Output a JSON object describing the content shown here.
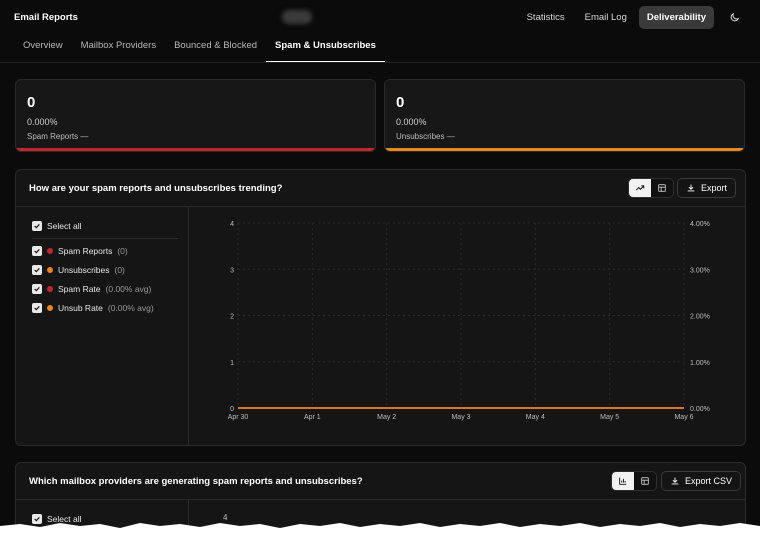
{
  "app": {
    "title": "Email Reports"
  },
  "topnav": {
    "items": [
      {
        "label": "Statistics",
        "active": false
      },
      {
        "label": "Email Log",
        "active": false
      },
      {
        "label": "Deliverability",
        "active": true
      }
    ],
    "theme_icon": "moon-icon"
  },
  "tabs": [
    {
      "label": "Overview",
      "active": false
    },
    {
      "label": "Mailbox Providers",
      "active": false
    },
    {
      "label": "Bounced & Blocked",
      "active": false
    },
    {
      "label": "Spam & Unsubscribes",
      "active": true
    }
  ],
  "stats": [
    {
      "value": "0",
      "percent": "0.000%",
      "label": "Spam Reports —",
      "color": "#c0272d"
    },
    {
      "value": "0",
      "percent": "0.000%",
      "label": "Unsubscribes —",
      "color": "#e8881d"
    }
  ],
  "trend_panel": {
    "title": "How are your spam reports and unsubscribes trending?",
    "export_label": "Export",
    "select_all": "Select all",
    "series": [
      {
        "label": "Spam Reports",
        "meta": "(0)",
        "color": "#c0272d"
      },
      {
        "label": "Unsubscribes",
        "meta": "(0)",
        "color": "#e8881d"
      },
      {
        "label": "Spam Rate",
        "meta": "(0.00% avg)",
        "color": "#c0272d"
      },
      {
        "label": "Unsub Rate",
        "meta": "(0.00% avg)",
        "color": "#e8881d"
      }
    ]
  },
  "providers_panel": {
    "title": "Which mailbox providers are generating spam reports and unsubscribes?",
    "export_label": "Export CSV",
    "select_all": "Select all",
    "first_tick": "4"
  },
  "chart_data": {
    "type": "line",
    "x": [
      "Apr 30",
      "Apr 1",
      "May 2",
      "May 3",
      "May 4",
      "May 5",
      "May 6"
    ],
    "ylim": [
      0,
      4
    ],
    "y_ticks": [
      "4",
      "3",
      "2",
      "1",
      "0"
    ],
    "y2lim": [
      0,
      4
    ],
    "y2_ticks": [
      "4.00%",
      "3.00%",
      "2.00%",
      "1.00%",
      "0.00%"
    ],
    "grid": true,
    "series": [
      {
        "name": "Spam Reports",
        "values": [
          0,
          0,
          0,
          0,
          0,
          0,
          0
        ],
        "color": "#c0272d"
      },
      {
        "name": "Unsubscribes",
        "values": [
          0,
          0,
          0,
          0,
          0,
          0,
          0
        ],
        "color": "#e8881d"
      },
      {
        "name": "Spam Rate",
        "values": [
          0,
          0,
          0,
          0,
          0,
          0,
          0
        ],
        "color": "#c0272d"
      },
      {
        "name": "Unsub Rate",
        "values": [
          0,
          0,
          0,
          0,
          0,
          0,
          0
        ],
        "color": "#e8881d"
      }
    ]
  }
}
